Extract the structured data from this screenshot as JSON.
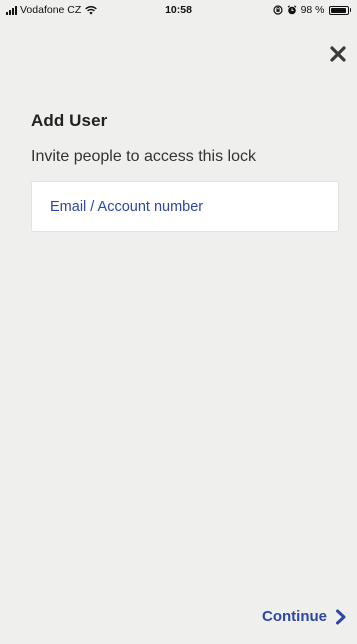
{
  "status_bar": {
    "carrier": "Vodafone CZ",
    "time": "10:58",
    "battery": "98 %",
    "battery_level": 0.98,
    "icons": [
      "signal-icon",
      "wifi-icon",
      "rotation-lock-icon",
      "alarm-icon",
      "battery-icon"
    ]
  },
  "header": {
    "close_icon": "close-icon"
  },
  "main": {
    "title": "Add User",
    "subtitle": "Invite people to access this lock",
    "email_field": {
      "placeholder": "Email / Account number",
      "value": ""
    }
  },
  "footer": {
    "continue_label": "Continue",
    "continue_icon": "chevron-right-icon"
  },
  "colors": {
    "accent": "#2d47a3",
    "background": "#efefed",
    "field_background": "#ffffff"
  }
}
